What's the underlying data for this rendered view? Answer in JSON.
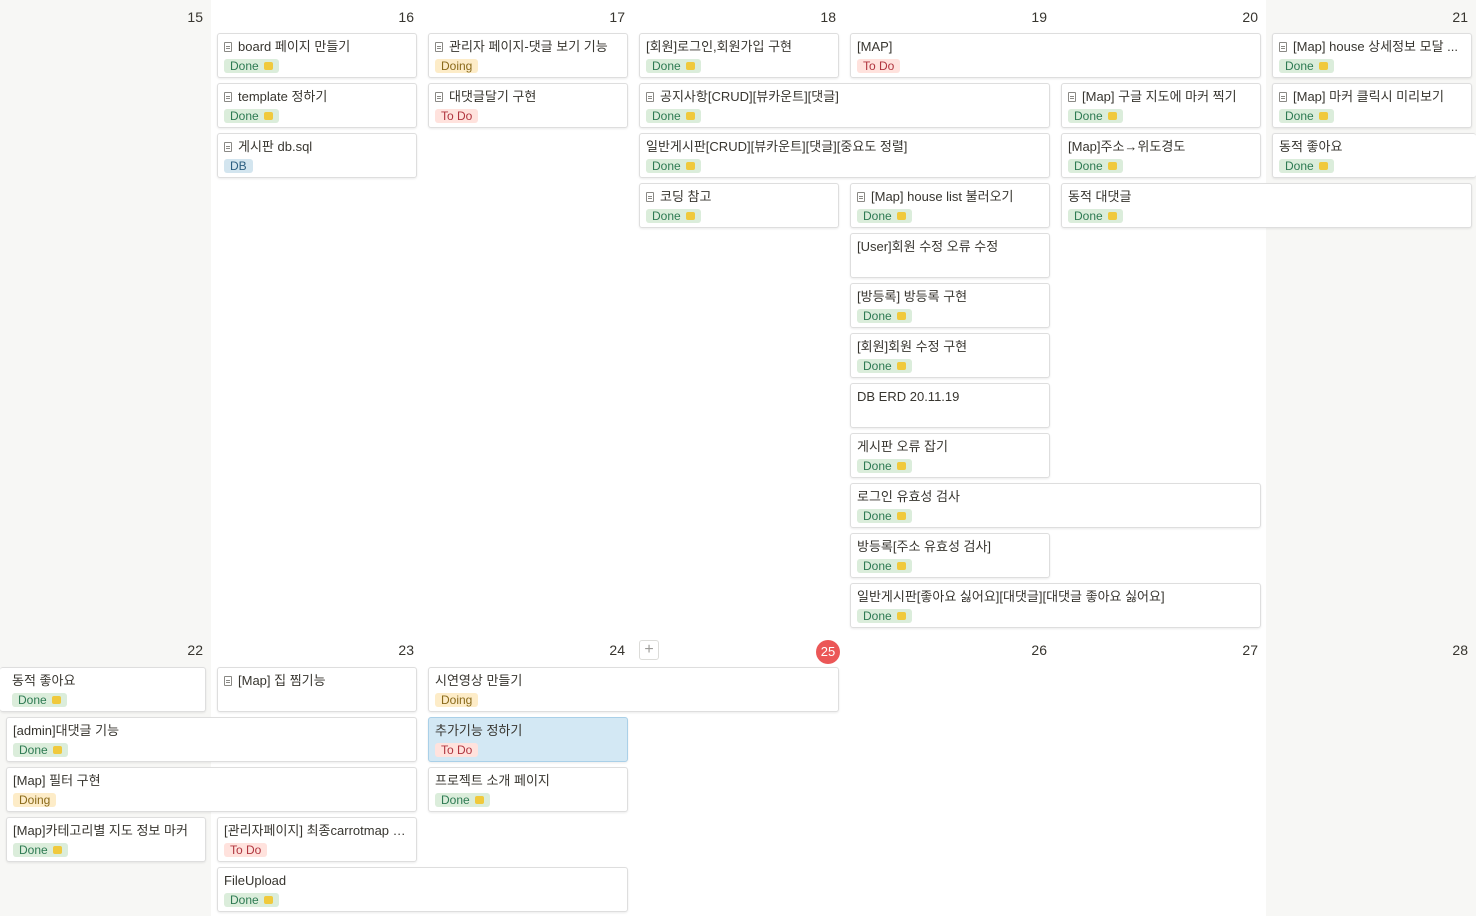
{
  "week1": {
    "days": [
      "15",
      "16",
      "17",
      "18",
      "19",
      "20",
      "21"
    ]
  },
  "week2": {
    "days": [
      "22",
      "23",
      "24",
      "25",
      "26",
      "27",
      "28"
    ],
    "today": "25",
    "add_label": "+"
  },
  "cards": {
    "c1": {
      "title": "board 페이지 만들기",
      "tag": "Done"
    },
    "c2": {
      "title": "template 정하기",
      "tag": "Done"
    },
    "c3": {
      "title": "게시판 db.sql",
      "tag": "DB"
    },
    "c4": {
      "title": "관리자 페이지-댓글 보기 기능",
      "tag": "Doing"
    },
    "c5": {
      "title": "대댓글달기 구현",
      "tag": "To Do"
    },
    "c6": {
      "title": "[회원]로그인,회원가입 구현",
      "tag": "Done"
    },
    "c7": {
      "title": "공지사항[CRUD][뷰카운트][댓글]",
      "tag": "Done"
    },
    "c8": {
      "title": "일반게시판[CRUD][뷰카운트][댓글][중요도 정렬]",
      "tag": "Done"
    },
    "c9": {
      "title": "코딩 참고",
      "tag": "Done"
    },
    "c10": {
      "title": "[MAP]",
      "tag": "To Do"
    },
    "c11": {
      "title": "[Map] house list 불러오기",
      "tag": "Done"
    },
    "c12": {
      "title": "[User]회원 수정 오류 수정",
      "tag": ""
    },
    "c13": {
      "title": "[방등록] 방등록 구현",
      "tag": "Done"
    },
    "c14": {
      "title": "[회원]회원 수정 구현",
      "tag": "Done"
    },
    "c15": {
      "title": "DB ERD 20.11.19",
      "tag": ""
    },
    "c16": {
      "title": "게시판 오류 잡기",
      "tag": "Done"
    },
    "c17": {
      "title": "로그인 유효성 검사",
      "tag": "Done"
    },
    "c18": {
      "title": "방등록[주소 유효성 검사]",
      "tag": "Done"
    },
    "c19": {
      "title": "일반게시판[좋아요 싫어요][대댓글][대댓글 좋아요 싫어요]",
      "tag": "Done"
    },
    "c20": {
      "title": "[Map] 구글 지도에 마커 찍기",
      "tag": "Done"
    },
    "c21": {
      "title": "[Map]주소→위도경도",
      "tag": "Done"
    },
    "c22": {
      "title": "동적 대댓글",
      "tag": "Done"
    },
    "c23": {
      "title": "[Map] house 상세정보 모달 ...",
      "tag": "Done"
    },
    "c24": {
      "title": "[Map] 마커 클릭시 미리보기",
      "tag": "Done"
    },
    "c25": {
      "title": "동적 좋아요",
      "tag": "Done"
    },
    "c26": {
      "title": "동적 좋아요",
      "tag": "Done"
    },
    "c27": {
      "title": "[admin]대댓글 기능",
      "tag": "Done"
    },
    "c28": {
      "title": "[Map] 필터 구현",
      "tag": "Doing"
    },
    "c29": {
      "title": "[Map]카테고리별 지도 정보 마커",
      "tag": "Done"
    },
    "c30": {
      "title": "[Map] 집 찜기능",
      "tag": ""
    },
    "c31": {
      "title": "[관리자페이지] 최종carrotmap d...",
      "tag": "To Do"
    },
    "c32": {
      "title": "FileUpload",
      "tag": "Done"
    },
    "c33": {
      "title": "시연영상 만들기",
      "tag": "Doing"
    },
    "c34": {
      "title": "추가기능 정하기",
      "tag": "To Do"
    },
    "c35": {
      "title": "프로젝트 소개 페이지",
      "tag": "Done"
    }
  },
  "colors": {
    "done_bg": "#dbeddb",
    "todo_bg": "#ffe2dd",
    "doing_bg": "#fdecc8",
    "db_bg": "#d3e5ef",
    "today": "#eb5757",
    "selected": "#d3e8f4"
  },
  "icons": {
    "page": "page-icon",
    "add": "plus-icon",
    "done_emoji": "party-emoji-icon"
  }
}
